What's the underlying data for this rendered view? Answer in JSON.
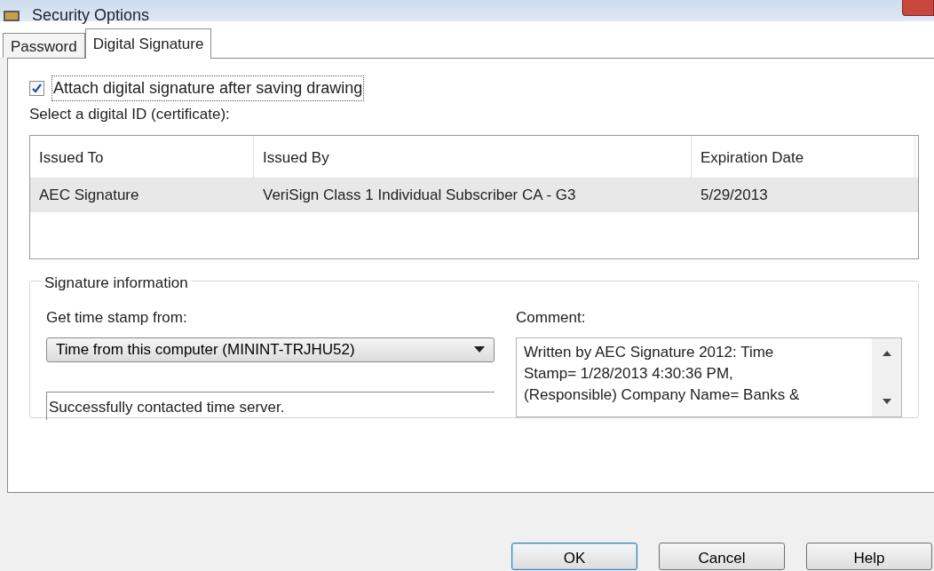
{
  "window": {
    "title": "Security Options"
  },
  "tabs": [
    {
      "label": "Password",
      "selected": false
    },
    {
      "label": "Digital Signature",
      "selected": true
    }
  ],
  "attach_checkbox": {
    "label": "Attach digital signature after saving drawing",
    "checked": true
  },
  "certificate_label": "Select a digital ID (certificate):",
  "table": {
    "columns": [
      "Issued To",
      "Issued By",
      "Expiration Date"
    ],
    "rows": [
      {
        "cells": [
          "AEC Signature",
          "VeriSign Class 1 Individual Subscriber CA - G3",
          "5/29/2013"
        ],
        "selected": true
      }
    ]
  },
  "signature_info": {
    "title": "Signature information",
    "time_stamp_label": "Get time stamp from:",
    "time_stamp_value": "Time from this computer (MININT-TRJHU52)",
    "status": "Successfully contacted time server.",
    "comment_label": "Comment:",
    "comment_lines": [
      "Written by AEC Signature 2012: Time",
      "Stamp= 1/28/2013 4:30:36 PM,",
      "(Responsible) Company Name= Banks &"
    ]
  },
  "buttons": [
    {
      "label": "OK",
      "default": true
    },
    {
      "label": "Cancel",
      "default": false
    },
    {
      "label": "Help",
      "default": false
    }
  ]
}
